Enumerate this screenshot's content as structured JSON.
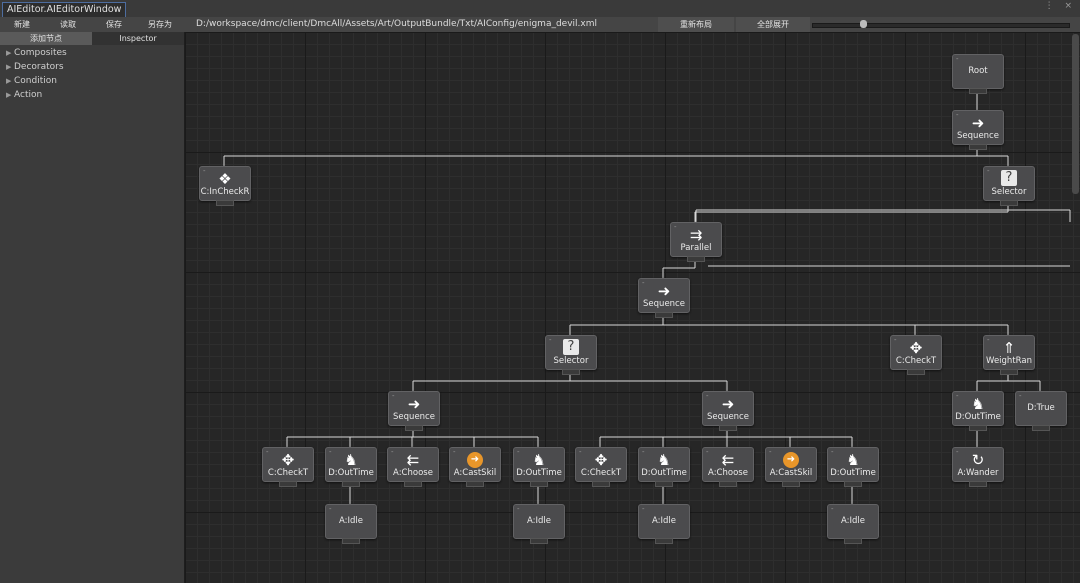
{
  "window": {
    "tab_title": "AIEditor.AIEditorWindow",
    "controls": "⋮ ×"
  },
  "toolbar": {
    "new_label": "新建",
    "load_label": "读取",
    "save_label": "保存",
    "save_as_label": "另存为",
    "file_path": "D:/workspace/dmc/client/DmcAll/Assets/Art/OutputBundle/Txt/AIConfig/enigma_devil.xml",
    "relayout_label": "重新布局",
    "expand_all_label": "全部展开",
    "zoom_level": 0.2
  },
  "sidebar": {
    "tabs": [
      {
        "label": "添加节点"
      },
      {
        "label": "Inspector"
      }
    ],
    "items": [
      {
        "label": "Composites",
        "arrow": "▶"
      },
      {
        "label": "Decorators",
        "arrow": "▶"
      },
      {
        "label": "Condition",
        "arrow": "▶"
      },
      {
        "label": "Action",
        "arrow": "▶"
      }
    ]
  },
  "nodes": [
    {
      "id": "root",
      "label": "Root",
      "icon": "",
      "icon_name": "none"
    },
    {
      "id": "seq1",
      "label": "Sequence",
      "icon": "➜",
      "icon_name": "sequence-arrow-icon"
    },
    {
      "id": "checkr",
      "label": "C:InCheckR",
      "icon": "❖",
      "icon_name": "condition-icon"
    },
    {
      "id": "sel1",
      "label": "Selector",
      "icon": "?",
      "icon_name": "selector-question-icon"
    },
    {
      "id": "par1",
      "label": "Parallel",
      "icon": "⇉",
      "icon_name": "parallel-arrows-icon"
    },
    {
      "id": "seq2",
      "label": "Sequence",
      "icon": "➜",
      "icon_name": "sequence-arrow-icon"
    },
    {
      "id": "sel2",
      "label": "Selector",
      "icon": "?",
      "icon_name": "selector-question-icon"
    },
    {
      "id": "checkt1",
      "label": "C:CheckT",
      "icon": "✥",
      "icon_name": "move-cross-icon"
    },
    {
      "id": "weight",
      "label": "WeightRan",
      "icon": "⇑",
      "icon_name": "weight-random-icon"
    },
    {
      "id": "seq3",
      "label": "Sequence",
      "icon": "➜",
      "icon_name": "sequence-arrow-icon"
    },
    {
      "id": "seq4",
      "label": "Sequence",
      "icon": "➜",
      "icon_name": "sequence-arrow-icon"
    },
    {
      "id": "outtime_r",
      "label": "D:OutTime",
      "icon": "♞",
      "icon_name": "outtime-icon"
    },
    {
      "id": "dtrue",
      "label": "D:True",
      "icon": "",
      "icon_name": "none"
    },
    {
      "id": "wander",
      "label": "A:Wander",
      "icon": "↻",
      "icon_name": "wander-loop-icon"
    },
    {
      "id": "checkt2",
      "label": "C:CheckT",
      "icon": "✥",
      "icon_name": "move-cross-icon"
    },
    {
      "id": "outtime1",
      "label": "D:OutTime",
      "icon": "♞",
      "icon_name": "outtime-icon"
    },
    {
      "id": "choose1",
      "label": "A:Choose",
      "icon": "⇇",
      "icon_name": "choose-icon"
    },
    {
      "id": "cast1",
      "label": "A:CastSkil",
      "icon": "➜",
      "icon_name": "cast-skill-orange-icon"
    },
    {
      "id": "outtime2",
      "label": "D:OutTime",
      "icon": "♞",
      "icon_name": "outtime-icon"
    },
    {
      "id": "checkt3",
      "label": "C:CheckT",
      "icon": "✥",
      "icon_name": "move-cross-icon"
    },
    {
      "id": "outtime3",
      "label": "D:OutTime",
      "icon": "♞",
      "icon_name": "outtime-icon"
    },
    {
      "id": "choose2",
      "label": "A:Choose",
      "icon": "⇇",
      "icon_name": "choose-icon"
    },
    {
      "id": "cast2",
      "label": "A:CastSkil",
      "icon": "➜",
      "icon_name": "cast-skill-orange-icon"
    },
    {
      "id": "outtime4",
      "label": "D:OutTime",
      "icon": "♞",
      "icon_name": "outtime-icon"
    },
    {
      "id": "idle1",
      "label": "A:Idle",
      "icon": "",
      "icon_name": "none"
    },
    {
      "id": "idle2",
      "label": "A:Idle",
      "icon": "",
      "icon_name": "none"
    },
    {
      "id": "idle3",
      "label": "A:Idle",
      "icon": "",
      "icon_name": "none"
    },
    {
      "id": "idle4",
      "label": "A:Idle",
      "icon": "",
      "icon_name": "none"
    }
  ],
  "colors": {
    "link": "#d8d8d8",
    "node_bg": "#4b4b4d",
    "accent_orange": "#e8962a"
  }
}
